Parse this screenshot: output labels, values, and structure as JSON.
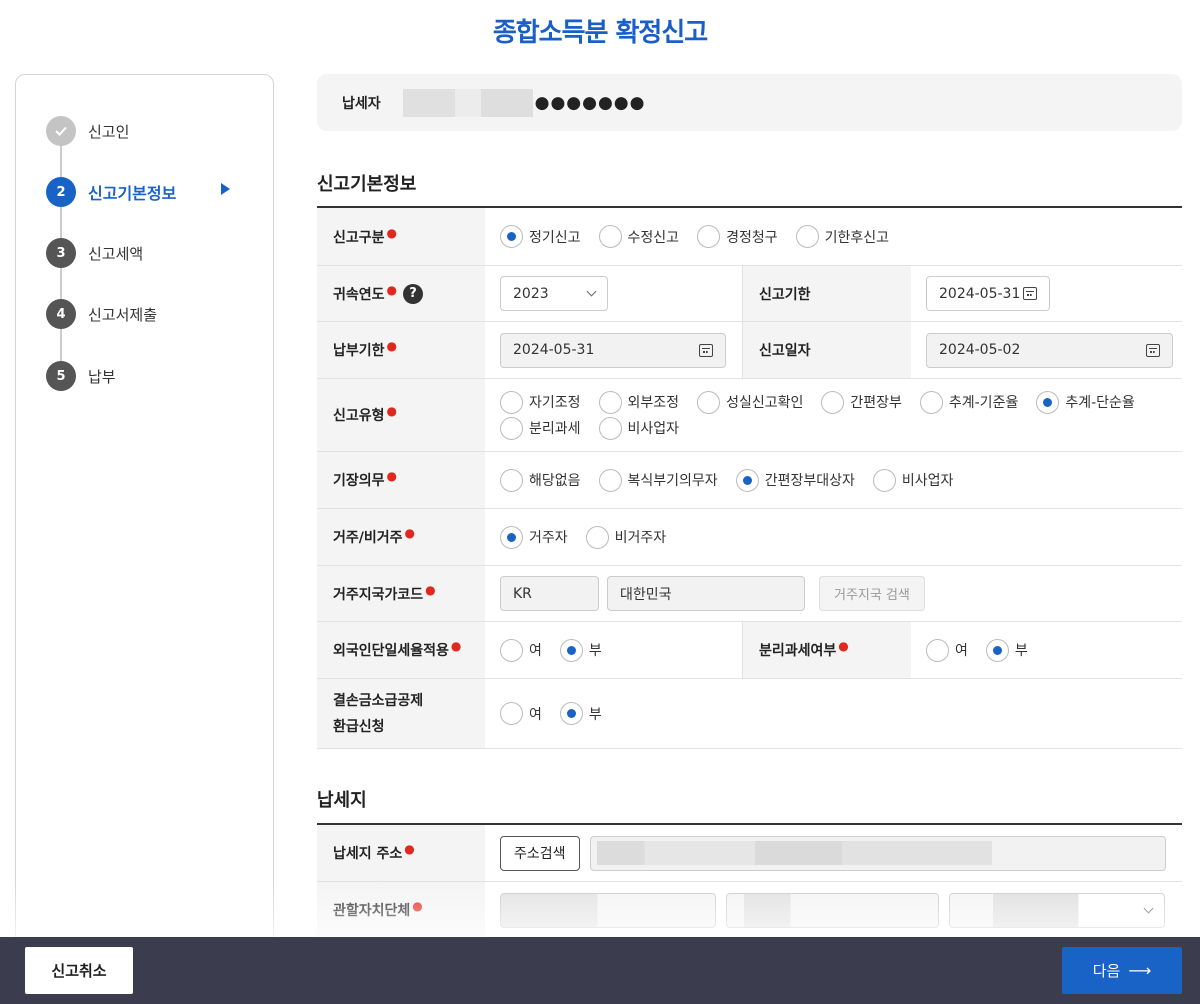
{
  "page": {
    "title": "종합소득분 확정신고"
  },
  "sidebar": {
    "steps": [
      {
        "number": "✓",
        "label": "신고인",
        "state": "done"
      },
      {
        "number": "2",
        "label": "신고기본정보",
        "state": "active"
      },
      {
        "number": "3",
        "label": "신고세액",
        "state": "pending"
      },
      {
        "number": "4",
        "label": "신고서제출",
        "state": "pending"
      },
      {
        "number": "5",
        "label": "납부",
        "state": "pending"
      }
    ]
  },
  "taxpayer": {
    "label": "납세자",
    "masked": "●●●●●●●"
  },
  "basic": {
    "section_title": "신고기본정보",
    "report_type": {
      "label": "신고구분",
      "options": [
        "정기신고",
        "수정신고",
        "경정청구",
        "기한후신고"
      ],
      "selected": "정기신고"
    },
    "year": {
      "label": "귀속연도",
      "value": "2023",
      "help": "?"
    },
    "report_deadline": {
      "label": "신고기한",
      "value": "2024-05-31"
    },
    "payment_deadline": {
      "label": "납부기한",
      "value": "2024-05-31"
    },
    "report_date": {
      "label": "신고일자",
      "value": "2024-05-02"
    },
    "filing_type": {
      "label": "신고유형",
      "options": [
        "자기조정",
        "외부조정",
        "성실신고확인",
        "간편장부",
        "추계-기준율",
        "추계-단순율",
        "분리과세",
        "비사업자"
      ],
      "selected": "추계-단순율"
    },
    "bookkeeping": {
      "label": "기장의무",
      "options": [
        "해당없음",
        "복식부기의무자",
        "간편장부대상자",
        "비사업자"
      ],
      "selected": "간편장부대상자"
    },
    "residency": {
      "label": "거주/비거주",
      "options": [
        "거주자",
        "비거주자"
      ],
      "selected": "거주자"
    },
    "country": {
      "label": "거주지국가코드",
      "code": "KR",
      "name": "대한민국",
      "search_button": "거주지국 검색"
    },
    "foreign_flat": {
      "label": "외국인단일세율적용",
      "options": [
        "여",
        "부"
      ],
      "selected": "부"
    },
    "separate_tax": {
      "label": "분리과세여부",
      "options": [
        "여",
        "부"
      ],
      "selected": "부"
    },
    "loss_refund": {
      "label_line1": "결손금소급공제",
      "label_line2": "환급신청",
      "options": [
        "여",
        "부"
      ],
      "selected": "부"
    }
  },
  "address": {
    "section_title": "납세지",
    "addr": {
      "label": "납세지 주소",
      "button": "주소검색"
    },
    "local_gov": {
      "label": "관할자치단체"
    }
  },
  "footer": {
    "cancel_label": "신고취소",
    "next_label": "다음",
    "next_arrow": "⟶"
  },
  "colors": {
    "accent": "#1a63c6",
    "required": "#e0281f",
    "footer_bg": "#3b3d4f"
  }
}
